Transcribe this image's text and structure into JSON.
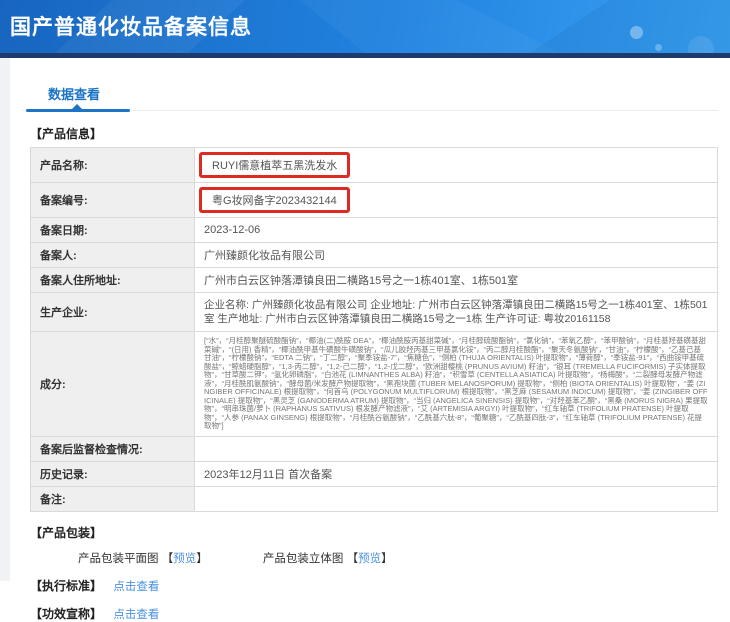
{
  "header": {
    "title": "国产普通化妆品备案信息"
  },
  "tab": {
    "label": "数据查看"
  },
  "product_info": {
    "section_title": "【产品信息】",
    "rows": [
      {
        "label": "产品名称:",
        "value": "RUYI儒意植萃五黑洗发水"
      },
      {
        "label": "备案编号:",
        "value": "粤G妆网备字2023432144"
      },
      {
        "label": "备案日期:",
        "value": "2023-12-06"
      },
      {
        "label": "备案人:",
        "value": "广州臻颜化妆品有限公司"
      },
      {
        "label": "备案人住所地址:",
        "value": "广州市白云区钟落潭镇良田二横路15号之一1栋401室、1栋501室"
      },
      {
        "label": "生产企业:",
        "value": "企业名称: 广州臻颜化妆品有限公司 企业地址: 广州市白云区钟落潭镇良田二横路15号之一1栋401室、1栋501室 生产地址: 广州市白云区钟落潭镇良田二横路15号之一1栋 生产许可证: 粤妆20161158"
      },
      {
        "label": "成分:",
        "value": "[“水”，“月桂醇聚醚硫酸酯钠”，“椰油(二)酰胺 DEA”，“椰油酰胺丙基甜菜碱”，“月桂醇硫酸酯钠”，“氯化钠”，“苯氧乙醇”，“苯甲酸钠”，“月桂基羟基磺基甜菜碱”，“(日用) 香精”，“椰油酰甲基牛磺酸牛磺酸钠”，“瓜儿胶羟丙基三甲基氯化铵”，“丙二醇月桂酸酯”，“聚天冬氨酸钠”，“甘油”，“柠檬酸”，“乙基己基甘油”，“柠檬酸钠”，“EDTA 二钠”，“丁二醇”，“聚季铵盐-7”，“焦糖色”，“侧柏 (THUJA ORIENTALIS) 叶提取物”，“薄荷醇”，“季铵盐-91”，“西曲铵甲基硫酸盐”，“鲸蜡硬脂醇”，“1,3-丙二醇”，“1,2-己二醇”，“1,2-戊二醇”，“欧洲甜樱桃 (PRUNUS AVIUM) 籽油”，“银耳 (TREMELLA FUCIFORMIS) 子实体提取物”，“甘草酸二钾”，“氢化卵磷脂”，“白池花 (LIMNANTHES ALBA) 籽油”，“积雪草 (CENTELLA ASIATICA) 叶提取物”，“杨梅酸”，“二裂酵母发酵产物滤液”，“月桂酰肌氨酸钠”，“酵母菌/米发酵产物提取物”，“黑孢块菌 (TUBER MELANOSPORUM) 提取物”，“侧柏 (BIOTA ORIENTALIS) 叶提取物”，“姜 (ZINGIBER OFFICINALE) 根提取物”，“何首乌 (POLYGONUM MULTIFLORUM) 根提取物”，“黑芝麻 (SESAMUM INDICUM) 提取物”，“姜 (ZINGIBER OFFICINALE) 提取物”，“黑灵芝 (GANODERMA ATRUM) 提取物”，“当归 (ANGELICA SINENSIS) 提取物”，“对羟基苯乙酮”，“黑桑 (MORUS NIGRA) 果提取物”，“明串珠菌/萝卜 (RAPHANUS SATIVUS) 根发酵产物滤液”，“艾 (ARTEMISIA ARGYI) 叶提取物”，“红车轴草 (TRIFOLIUM PRATENSE) 叶提取物”，“人参 (PANAX GINSENG) 根提取物”，“月桂酰谷氨酸钠”，“乙酰基六肽-8”，“葡聚糖”，“乙酰基四肽-3”，“红车轴草 (TRIFOLIUM PRATENSE) 花提取物”]"
      },
      {
        "label": "备案后监督检查情况:",
        "value": ""
      },
      {
        "label": "历史记录:",
        "value": "2023年12月11日 首次备案"
      },
      {
        "label": "备注:",
        "value": ""
      }
    ]
  },
  "packaging": {
    "section_title": "【产品包装】",
    "flat": {
      "label": "产品包装平面图",
      "bracket_open": "【",
      "link": "预览",
      "bracket_close": "】"
    },
    "stereo": {
      "label": "产品包装立体图",
      "bracket_open": "【",
      "link": "预览",
      "bracket_close": "】"
    }
  },
  "standards": {
    "section_title": "【执行标准】",
    "link": "点击查看"
  },
  "efficacy": {
    "section_title": "【功效宣称】",
    "link": "点击查看"
  },
  "colors": {
    "banner_start": "#1765bf",
    "banner_end": "#3aa2f2",
    "banner_edge": "#1e3b6d",
    "accent_blue": "#1b74c5",
    "highlight_red": "#dd2a22",
    "link_blue": "#4a90e2",
    "label_bg": "#efefef"
  }
}
